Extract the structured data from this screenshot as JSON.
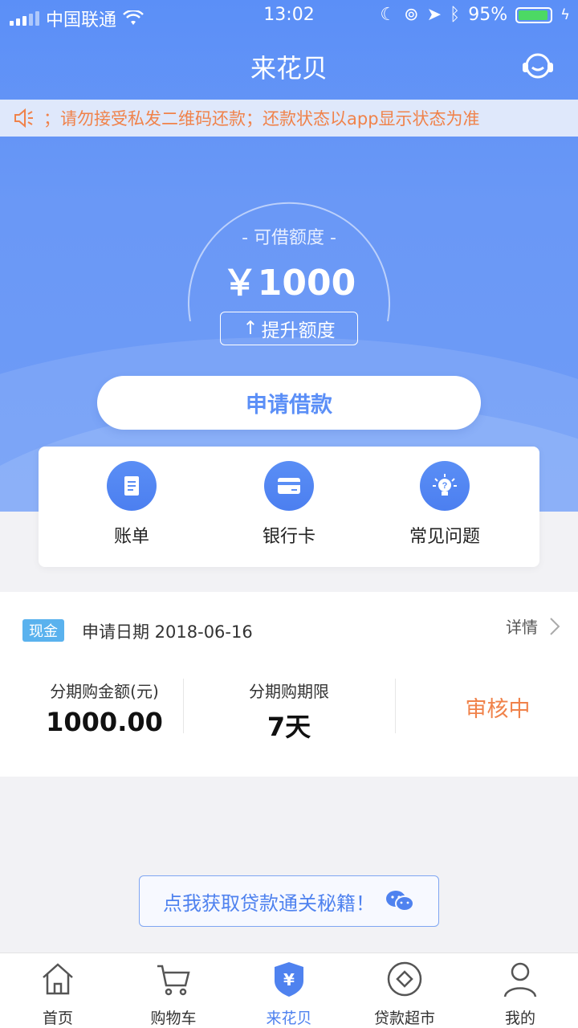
{
  "status_bar": {
    "carrier": "中国联通",
    "time": "13:02",
    "battery": "95%"
  },
  "header": {
    "title": "来花贝",
    "support_icon": "customer-service-icon"
  },
  "notice": {
    "text": "；请勿接受私发二维码还款；还款状态以app显示状态为准",
    "icon": "speaker-icon"
  },
  "credit": {
    "label": "- 可借额度 -",
    "amount": "￥1000",
    "raise_label": "提升额度",
    "raise_icon": "↑"
  },
  "apply_button": "申请借款",
  "quick_menu": [
    {
      "label": "账单",
      "icon": "bill-icon"
    },
    {
      "label": "银行卡",
      "icon": "bank-card-icon"
    },
    {
      "label": "常见问题",
      "icon": "faq-icon"
    }
  ],
  "loan": {
    "tag": "现金",
    "apply_date": "申请日期 2018-06-16",
    "detail_link": "详情",
    "amount_label": "分期购金额(元)",
    "amount_value": "1000.00",
    "term_label": "分期购期限",
    "term_value": "7天",
    "status": "审核中"
  },
  "promo": {
    "text": "点我获取贷款通关秘籍！",
    "icon": "wechat-icon"
  },
  "tabbar": [
    {
      "label": "首页",
      "icon": "home-icon",
      "active": false
    },
    {
      "label": "购物车",
      "icon": "cart-icon",
      "active": false
    },
    {
      "label": "来花贝",
      "icon": "yen-shield-icon",
      "active": true
    },
    {
      "label": "贷款超市",
      "icon": "loan-market-icon",
      "active": false
    },
    {
      "label": "我的",
      "icon": "profile-icon",
      "active": false
    }
  ],
  "colors": {
    "primary": "#5b8ff7",
    "accent_orange": "#f0824a",
    "tag_blue": "#5ab2ee"
  }
}
